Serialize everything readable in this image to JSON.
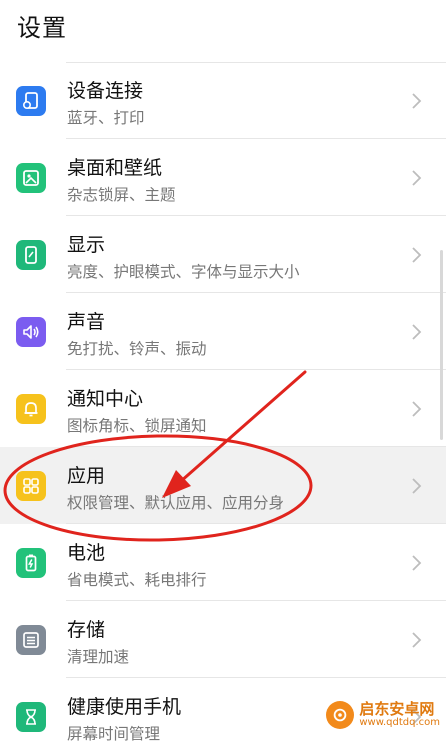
{
  "page": {
    "title": "设置"
  },
  "colors": {
    "accent_red": "#e0241d",
    "icon_blue": "#2d7bf0",
    "icon_green": "#22c27a",
    "icon_purple": "#7b5cf0",
    "icon_yellow": "#f6c21c",
    "icon_gray": "#808a96",
    "icon_teal": "#1fb87a"
  },
  "items": [
    {
      "label": "设备连接",
      "sub": "蓝牙、打印",
      "icon": "device-link-icon"
    },
    {
      "label": "桌面和壁纸",
      "sub": "杂志锁屏、主题",
      "icon": "wallpaper-icon"
    },
    {
      "label": "显示",
      "sub": "亮度、护眼模式、字体与显示大小",
      "icon": "display-icon"
    },
    {
      "label": "声音",
      "sub": "免打扰、铃声、振动",
      "icon": "sound-icon"
    },
    {
      "label": "通知中心",
      "sub": "图标角标、锁屏通知",
      "icon": "bell-icon"
    },
    {
      "label": "应用",
      "sub": "权限管理、默认应用、应用分身",
      "icon": "apps-grid-icon"
    },
    {
      "label": "电池",
      "sub": "省电模式、耗电排行",
      "icon": "battery-icon"
    },
    {
      "label": "存储",
      "sub": "清理加速",
      "icon": "storage-icon"
    },
    {
      "label": "健康使用手机",
      "sub": "屏幕时间管理",
      "icon": "hourglass-icon"
    }
  ],
  "watermark": {
    "name": "启东安卓网",
    "url": "www.qdtdq.com"
  }
}
